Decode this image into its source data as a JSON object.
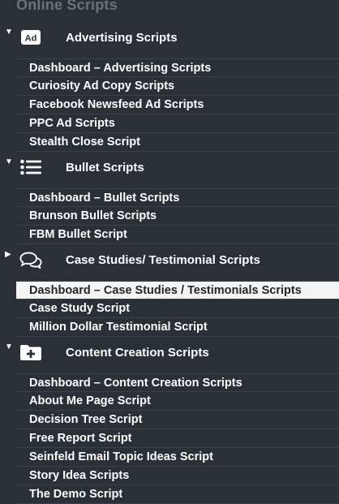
{
  "header": {
    "title": "Online Scripts"
  },
  "sections": [
    {
      "title": "Advertising Scripts",
      "icon": "ad-badge-icon",
      "expanded": true,
      "items": [
        "Dashboard – Advertising Scripts",
        "Curiosity Ad Copy Scripts",
        "Facebook Newsfeed Ad Scripts",
        "PPC Ad Scripts",
        "Stealth Close Script"
      ]
    },
    {
      "title": "Bullet Scripts",
      "icon": "bullet-list-icon",
      "expanded": true,
      "items": [
        "Dashboard – Bullet Scripts",
        "Brunson Bullet Scripts",
        "FBM Bullet Script"
      ]
    },
    {
      "title": "Case Studies/ Testimonial Scripts",
      "icon": "chat-bubbles-icon",
      "expanded": false,
      "items": [
        "Dashboard – Case Studies / Testimonials Scripts",
        "Case Study Script",
        "Million Dollar Testimonial Script"
      ],
      "active_index": 0
    },
    {
      "title": "Content Creation Scripts",
      "icon": "folder-plus-icon",
      "expanded": true,
      "items": [
        "Dashboard – Content Creation Scripts",
        "About Me Page Script",
        "Decision Tree Script",
        "Free Report Script",
        "Seinfeld Email Topic Ideas Script",
        "Story Idea Scripts",
        "The Demo Script"
      ]
    }
  ],
  "icons": {
    "ad_badge_text": "Ad"
  },
  "colors": {
    "background": "#2b3036",
    "active_bg": "#f4f4f4",
    "header_text": "#6b727a"
  }
}
